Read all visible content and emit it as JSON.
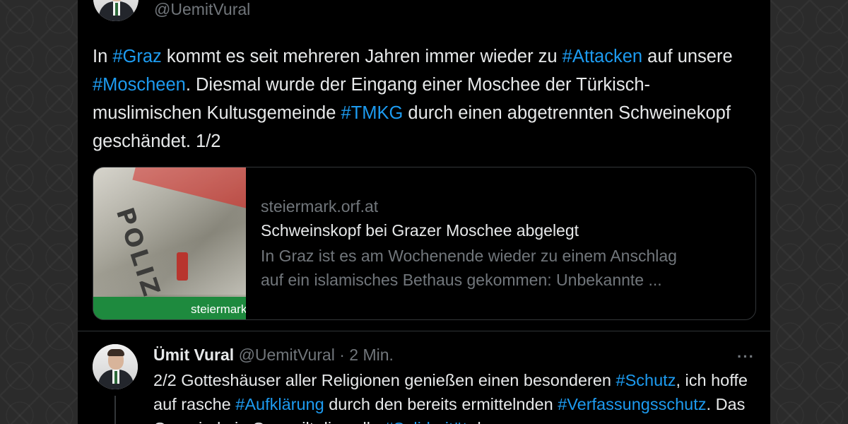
{
  "top_tweet": {
    "handle": "@UemitVural",
    "segments": [
      {
        "t": "In ",
        "tag": false
      },
      {
        "t": "#Graz",
        "tag": true
      },
      {
        "t": " kommt es seit mehreren Jahren immer wieder zu ",
        "tag": false
      },
      {
        "t": "#Attacken",
        "tag": true
      },
      {
        "t": " auf unsere ",
        "tag": false
      },
      {
        "t": "#Moscheen",
        "tag": true
      },
      {
        "t": ". Diesmal wurde der Eingang einer Moschee der Türkisch-muslimischen Kultusgemeinde ",
        "tag": false
      },
      {
        "t": "#TMKG",
        "tag": true
      },
      {
        "t": " durch einen abgetrennten Schweinekopf geschändet. 1/2",
        "tag": false
      }
    ]
  },
  "link_card": {
    "thumb_word": "POLIZEI",
    "thumb_label": "steiermark",
    "domain": "steiermark.orf.at",
    "title": "Schweinskopf bei Grazer Moschee abgelegt",
    "description_line1": "In Graz ist es am Wochenende wieder zu einem Anschlag",
    "description_line2": "auf ein islamisches Bethaus gekommen: Unbekannte ..."
  },
  "reply": {
    "name": "Ümit Vural",
    "handle": "@UemitVural",
    "separator": " · ",
    "time": "2 Min.",
    "more_icon": "···",
    "segments": [
      {
        "t": "2/2 Gotteshäuser aller Religionen genießen einen besonderen ",
        "tag": false
      },
      {
        "t": "#Schutz",
        "tag": true
      },
      {
        "t": ", ich hoffe auf rasche ",
        "tag": false
      },
      {
        "t": "#Aufklärung",
        "tag": true
      },
      {
        "t": " durch den bereits ermittelnden ",
        "tag": false
      },
      {
        "t": "#Verfassungsschutz",
        "tag": true
      },
      {
        "t": ". Das Gemeinde in Graz gilt die volle ",
        "tag": false
      },
      {
        "t": "#Solidarität",
        "tag": true
      },
      {
        "t": " der",
        "tag": false
      }
    ]
  },
  "colors": {
    "background": "#000000",
    "text": "#e7e9ea",
    "muted": "#71767b",
    "hashtag": "#1d9bf0",
    "orf_green": "#1e8a3e"
  }
}
